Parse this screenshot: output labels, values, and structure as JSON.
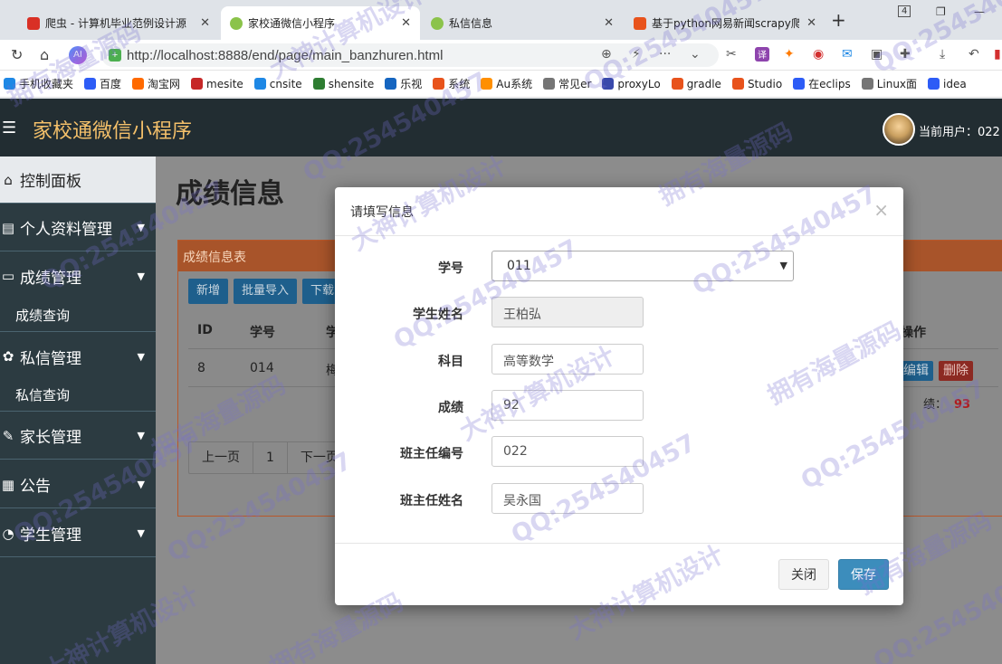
{
  "browser": {
    "tabs": [
      {
        "title": "爬虫 - 计算机毕业范例设计源",
        "favicon_color": "#d93025",
        "active": false
      },
      {
        "title": "家校通微信小程序",
        "favicon_color": "#8bc34a",
        "active": true
      },
      {
        "title": "私信信息",
        "favicon_color": "#8bc34a",
        "active": false
      },
      {
        "title": "基于python网易新闻scrapy爬",
        "favicon_color": "#e8531c",
        "active": false
      }
    ],
    "url": "http://localhost:8888/end/page/main_banzhuren.html",
    "window_badge": "4",
    "bookmarks": [
      {
        "label": "手机收藏夹",
        "color": "#1e88e5"
      },
      {
        "label": "百度",
        "color": "#2d5cf6"
      },
      {
        "label": "淘宝网",
        "color": "#ff6a00"
      },
      {
        "label": "mesite",
        "color": "#c62828"
      },
      {
        "label": "cnsite",
        "color": "#1e88e5"
      },
      {
        "label": "shensite",
        "color": "#2e7d32"
      },
      {
        "label": "乐视",
        "color": "#1565c0"
      },
      {
        "label": "系统",
        "color": "#e8531c"
      },
      {
        "label": "Au系统",
        "color": "#ff8f00"
      },
      {
        "label": "常见er",
        "color": "#757575"
      },
      {
        "label": "proxyLo",
        "color": "#3949ab"
      },
      {
        "label": "gradle",
        "color": "#e8531c"
      },
      {
        "label": "Studio",
        "color": "#e8531c"
      },
      {
        "label": "在eclips",
        "color": "#2d5cf6"
      },
      {
        "label": "Linux面",
        "color": "#757575"
      },
      {
        "label": "idea",
        "color": "#2d5cf6"
      }
    ]
  },
  "app": {
    "title": "家校通微信小程序",
    "current_user_label": "当前用户：022"
  },
  "sidebar": {
    "items": [
      {
        "label": "控制面板",
        "icon": "home-icon",
        "selected": true
      },
      {
        "label": "个人资料管理",
        "icon": "list-icon"
      },
      {
        "label": "成绩管理",
        "icon": "monitor-icon"
      },
      {
        "sub": "成绩查询"
      },
      {
        "label": "私信管理",
        "icon": "settings-icon"
      },
      {
        "sub": "私信查询"
      },
      {
        "label": "家长管理",
        "icon": "wrench-icon"
      },
      {
        "label": "公告",
        "icon": "calendar-icon"
      },
      {
        "label": "学生管理",
        "icon": "pie-icon"
      }
    ]
  },
  "main": {
    "page_title": "成绩信息",
    "panel_title": "成绩信息表",
    "buttons": [
      "新增",
      "批量导入",
      "下载"
    ],
    "table_headers": {
      "id": "ID",
      "student_no": "学号",
      "student_name_partial": "学",
      "ops": "操作"
    },
    "row": {
      "id": "8",
      "student_no": "014",
      "name_partial": "梅",
      "edit": "编辑",
      "delete": "删除"
    },
    "summary_label": "绩：",
    "summary_value": "93",
    "pager": [
      "上一页",
      "1",
      "下一页"
    ]
  },
  "modal": {
    "title": "请填写信息",
    "close_x": "×",
    "fields": {
      "student_no_label": "学号",
      "student_no_value": "011",
      "student_name_label": "学生姓名",
      "student_name_value": "王柏弘",
      "subject_label": "科目",
      "subject_value": "高等数学",
      "score_label": "成绩",
      "score_value": "92",
      "teacher_no_label": "班主任编号",
      "teacher_no_value": "022",
      "teacher_name_label": "班主任姓名",
      "teacher_name_value": "吴永国"
    },
    "close_button": "关闭",
    "save_button": "保存"
  },
  "watermarks": [
    "QQ:254540457",
    "大神计算机设计",
    "拥有海量源码"
  ]
}
